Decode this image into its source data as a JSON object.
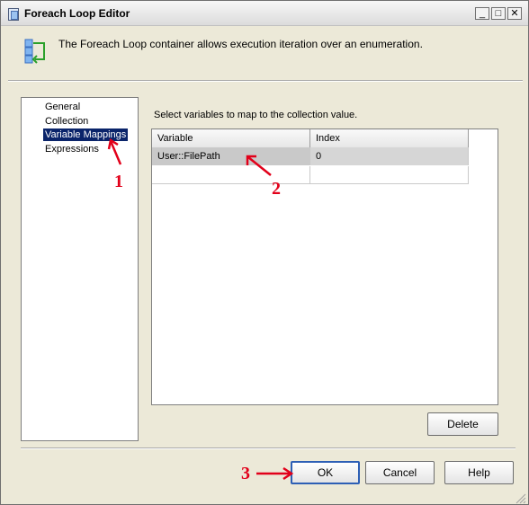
{
  "window": {
    "title": "Foreach Loop Editor",
    "controls": {
      "minimize": "_",
      "maximize": "□",
      "close": "✕"
    }
  },
  "header": {
    "description": "The Foreach Loop container allows execution iteration over an enumeration.",
    "icon": "foreach-loop-icon"
  },
  "nav": {
    "items": [
      {
        "label": "General",
        "selected": false
      },
      {
        "label": "Collection",
        "selected": false
      },
      {
        "label": "Variable Mappings",
        "selected": true
      },
      {
        "label": "Expressions",
        "selected": false
      }
    ]
  },
  "main": {
    "instruction": "Select variables to map to the collection value.",
    "grid": {
      "columns": [
        "Variable",
        "Index"
      ],
      "rows": [
        {
          "variable": "User::FilePath",
          "index": "0"
        },
        {
          "variable": "",
          "index": ""
        }
      ]
    },
    "delete_label": "Delete"
  },
  "footer": {
    "ok_label": "OK",
    "cancel_label": "Cancel",
    "help_label": "Help"
  },
  "annotations": {
    "marker_1": "1",
    "marker_2": "2",
    "marker_3": "3",
    "color": "#e2001a"
  }
}
